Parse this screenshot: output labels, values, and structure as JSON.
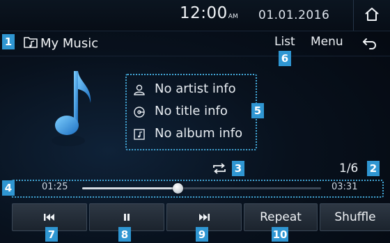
{
  "statusbar": {
    "time": "12:00",
    "ampm": "AM",
    "date": "01.01.2016",
    "home_icon": "home-icon"
  },
  "header": {
    "title": "My Music",
    "title_icon": "music-folder-icon",
    "list_label": "List",
    "menu_label": "Menu",
    "back_icon": "back-arrow-icon"
  },
  "track_info": {
    "artist": "No artist info",
    "title": "No title info",
    "album": "No album info",
    "artist_icon": "person-icon",
    "title_icon": "disc-icon",
    "album_icon": "album-icon"
  },
  "playback": {
    "elapsed": "01:25",
    "duration": "03:31",
    "progress_fraction": 0.4,
    "track_count": "1/6",
    "repeat_icon": "repeat-icon"
  },
  "controls": {
    "prev_icon": "skip-previous-icon",
    "pause_icon": "pause-icon",
    "next_icon": "skip-next-icon",
    "repeat_label": "Repeat",
    "shuffle_label": "Shuffle"
  },
  "markers": [
    "1",
    "2",
    "3",
    "4",
    "5",
    "6",
    "7",
    "8",
    "9",
    "10"
  ],
  "colors": {
    "accent": "#2f96d2",
    "highlight_border": "#43a8d8",
    "note": "#3aa0e0"
  }
}
